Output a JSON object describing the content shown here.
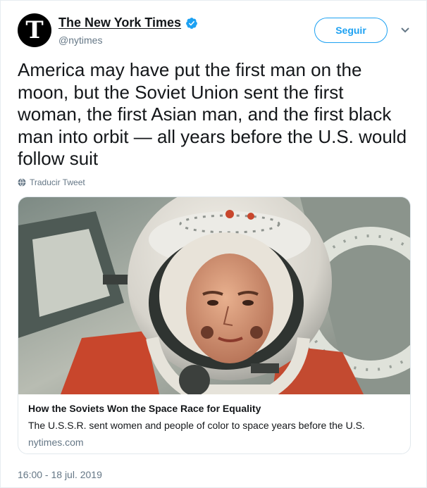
{
  "author": {
    "display_name": "The New York Times",
    "handle": "@nytimes",
    "verified": true,
    "avatar_glyph": "T"
  },
  "follow_button": {
    "label": "Seguir"
  },
  "tweet": {
    "text": "America may have put the first man on the moon, but the Soviet Union sent the first woman, the first Asian man, and the first black man into orbit — all years before the U.S. would follow suit",
    "translate_label": "Traducir Tweet",
    "timestamp": "16:00 - 18 jul. 2019"
  },
  "card": {
    "title": "How the Soviets Won the Space Race for Equality",
    "description": "The U.S.S.R. sent women and people of color to space years before the U.S.",
    "domain": "nytimes.com"
  },
  "colors": {
    "accent": "#1da1f2",
    "text": "#14171a",
    "muted": "#657786",
    "border": "#e1e8ed"
  },
  "icons": [
    "verified-badge-icon",
    "chevron-down-icon",
    "globe-icon"
  ]
}
